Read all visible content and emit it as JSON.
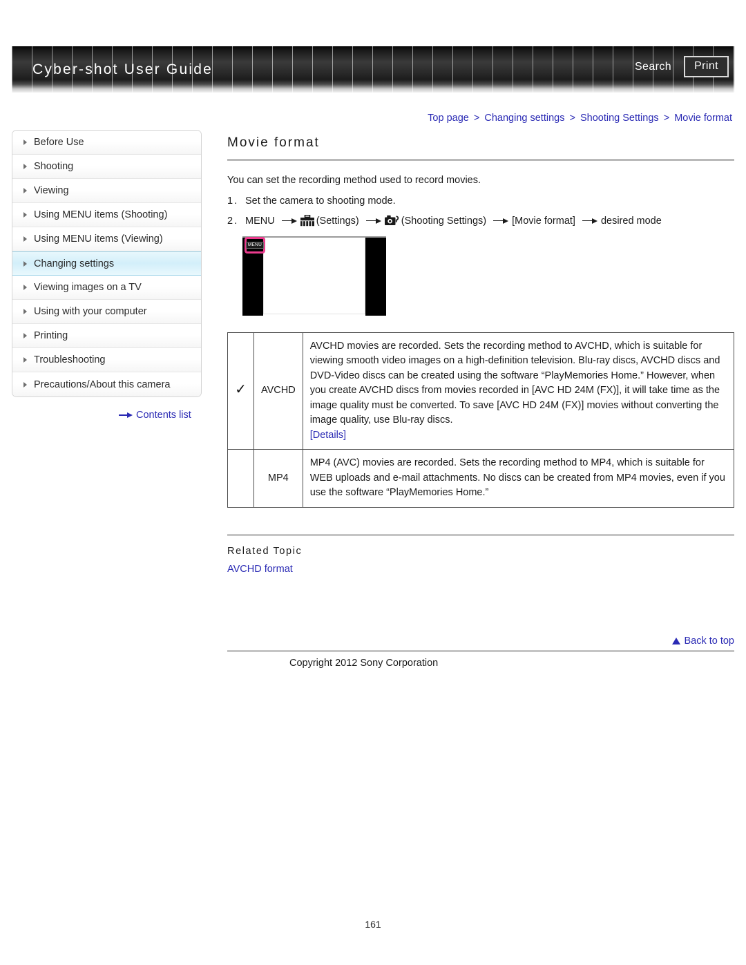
{
  "header": {
    "title": "Cyber-shot User Guide",
    "search_label": "Search",
    "print_label": "Print"
  },
  "breadcrumb": {
    "items": [
      "Top page",
      "Changing settings",
      "Shooting Settings",
      "Movie format"
    ],
    "separator": ">"
  },
  "sidebar": {
    "items": [
      {
        "label": "Before Use",
        "active": false
      },
      {
        "label": "Shooting",
        "active": false
      },
      {
        "label": "Viewing",
        "active": false
      },
      {
        "label": "Using MENU items (Shooting)",
        "active": false
      },
      {
        "label": "Using MENU items (Viewing)",
        "active": false
      },
      {
        "label": "Changing settings",
        "active": true
      },
      {
        "label": "Viewing images on a TV",
        "active": false
      },
      {
        "label": "Using with your computer",
        "active": false
      },
      {
        "label": "Printing",
        "active": false
      },
      {
        "label": "Troubleshooting",
        "active": false
      },
      {
        "label": "Precautions/About this camera",
        "active": false
      }
    ],
    "contents_list_label": "Contents list"
  },
  "main": {
    "page_title": "Movie format",
    "intro": "You can set the recording method used to record movies.",
    "steps": [
      {
        "number": "1.",
        "text": "Set the camera to shooting mode."
      },
      {
        "number": "2.",
        "parts": {
          "menu": "MENU",
          "settings_label": "(Settings)",
          "shooting_settings_label": "(Shooting Settings)",
          "movie_format_label": "[Movie format]",
          "desired_mode_label": "desired mode"
        }
      }
    ],
    "illustration": {
      "menu_button_text": "MENU"
    },
    "table": {
      "rows": [
        {
          "checked": true,
          "check_glyph": "✅",
          "name": "AVCHD",
          "description": "AVCHD movies are recorded. Sets the recording method to AVCHD, which is suitable for viewing smooth video images on a high-definition television. Blu-ray discs, AVCHD discs and DVD-Video discs can be created using the software “PlayMemories Home.” However, when you create AVCHD discs from movies recorded in [AVC HD 24M (FX)], it will take time as the image quality must be converted. To save [AVC HD 24M (FX)] movies without converting the image quality, use Blu-ray discs. ",
          "link": "[Details]"
        },
        {
          "checked": false,
          "name": "MP4",
          "description": "MP4 (AVC) movies are recorded. Sets the recording method to MP4, which is suitable for WEB uploads and e-mail attachments. No discs can be created from MP4 movies, even if you use the software “PlayMemories Home.”",
          "link": ""
        }
      ]
    },
    "related": {
      "heading": "Related Topic",
      "link": "AVCHD format"
    }
  },
  "footer": {
    "back_to_top": "Back to top",
    "copyright": "Copyright 2012 Sony Corporation",
    "page_number": "161"
  },
  "colors": {
    "link": "#2a2ab4",
    "highlight": "#ec3c8e",
    "sidebar_active": "#d3effa"
  }
}
